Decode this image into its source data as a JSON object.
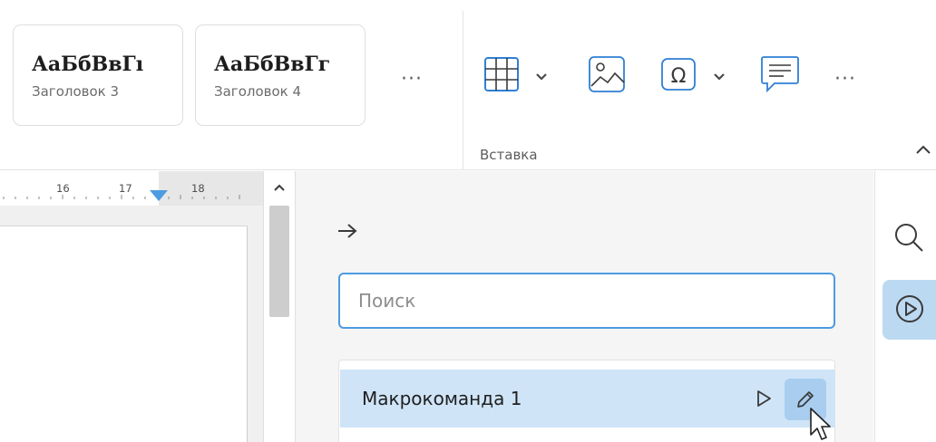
{
  "ribbon": {
    "style_cards": [
      {
        "name": "АаБбВвГı",
        "subtitle": "Заголовок 3"
      },
      {
        "name": "АаБбВвГг",
        "subtitle": "Заголовок 4"
      }
    ],
    "more_styles_label": "···",
    "insert_group": {
      "label": "Вставка",
      "more_label": "···",
      "tools": [
        "table-icon",
        "image-icon",
        "special-character-icon",
        "comment-icon"
      ]
    }
  },
  "ruler": {
    "numbers": [
      "16",
      "17",
      "18"
    ]
  },
  "macros_panel": {
    "search_placeholder": "Поиск",
    "items": [
      {
        "label": "Макрокоманда 1"
      }
    ]
  },
  "colors": {
    "accent": "#4d9be0",
    "selection": "#cfe4f7",
    "active_tool": "#a8cdef"
  }
}
